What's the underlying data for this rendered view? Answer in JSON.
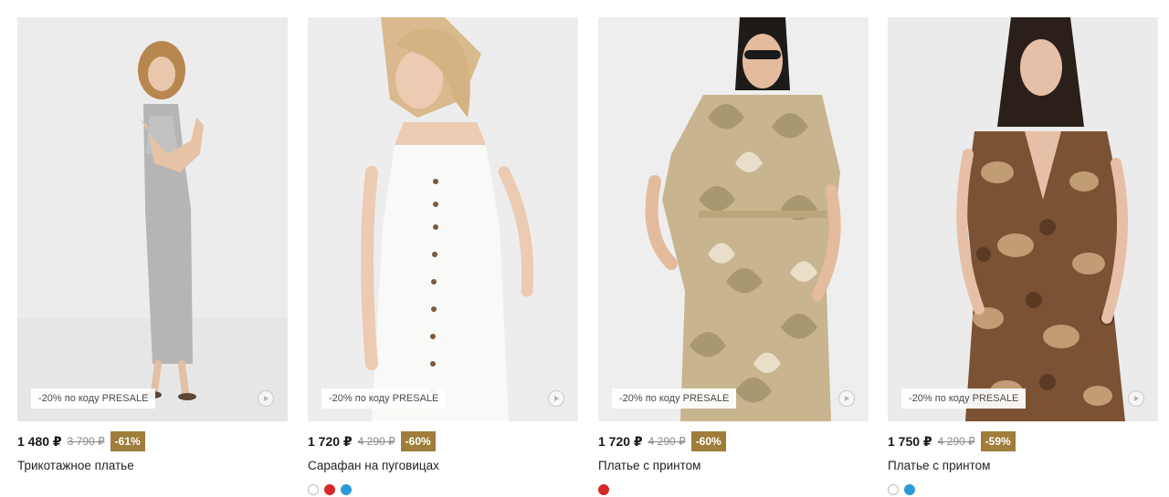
{
  "products": [
    {
      "price": "1 480 ₽",
      "old_price": "3 790 ₽",
      "discount": "-61%",
      "promo": "-20% по коду PRESALE",
      "name": "Трикотажное платье",
      "swatches": []
    },
    {
      "price": "1 720 ₽",
      "old_price": "4 290 ₽",
      "discount": "-60%",
      "promo": "-20% по коду PRESALE",
      "name": "Сарафан на пуговицах",
      "swatches": [
        "#ffffff",
        "#d62a2a",
        "#2b9bd6"
      ]
    },
    {
      "price": "1 720 ₽",
      "old_price": "4 290 ₽",
      "discount": "-60%",
      "promo": "-20% по коду PRESALE",
      "name": "Платье с принтом",
      "swatches": [
        "#d62a2a"
      ]
    },
    {
      "price": "1 750 ₽",
      "old_price": "4 290 ₽",
      "discount": "-59%",
      "promo": "-20% по коду PRESALE",
      "name": "Платье с принтом",
      "swatches": [
        "#ffffff",
        "#2b9bd6"
      ]
    }
  ],
  "colors": {
    "discount_badge": "#a07d3b",
    "old_price": "#8a8a8a",
    "photo_bg": "#ebebeb"
  },
  "icons": {
    "video": "play-icon"
  }
}
